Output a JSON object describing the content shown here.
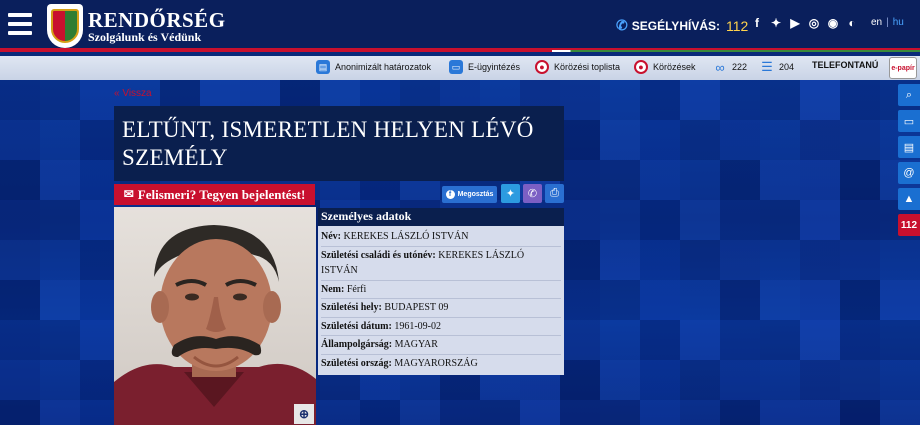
{
  "header": {
    "brand_title": "RENDŐRSÉG",
    "brand_subtitle": "Szolgálunk és Védünk",
    "emergency_label": "SEGÉLYHÍVÁS:",
    "emergency_number": "112",
    "social_icons": [
      "facebook-icon",
      "twitter-icon",
      "youtube-icon",
      "instagram-icon",
      "rss-icon",
      "accessibility-icon"
    ],
    "lang_en": "en",
    "lang_hu": "hu"
  },
  "toolbar": {
    "anon": "Anonimizált határozatok",
    "eugy": "E-ügyintézés",
    "toplista": "Körözési toplista",
    "korozesek": "Körözések",
    "count1": "222",
    "count2": "204",
    "telefon": "TELEFONTANÚ",
    "epapir": "e-papír"
  },
  "sidebar": {
    "icons": [
      "search-icon",
      "monitor-icon",
      "document-icon",
      "at-icon",
      "road-icon",
      "emergency-112-icon"
    ],
    "emergency_label": "112"
  },
  "main": {
    "back_link": "« Vissza",
    "title": "ELTŰNT, ISMERETLEN HELYEN LÉVŐ SZEMÉLY",
    "report_button": "Felismeri? Tegyen bejelentést!",
    "share_label": "Megosztás"
  },
  "personal_data": {
    "heading": "Személyes adatok",
    "rows": [
      {
        "key": "Név:",
        "value": "KEREKES LÁSZLÓ ISTVÁN"
      },
      {
        "key": "Születési családi és utónév:",
        "value": "KEREKES LÁSZLÓ ISTVÁN"
      },
      {
        "key": "Nem:",
        "value": "Férfi"
      },
      {
        "key": "Születési hely:",
        "value": "BUDAPEST 09"
      },
      {
        "key": "Születési dátum:",
        "value": "1961-09-02"
      },
      {
        "key": "Állampolgárság:",
        "value": "MAGYAR"
      },
      {
        "key": "Születési ország:",
        "value": "MAGYARORSZÁG"
      }
    ]
  },
  "colors": {
    "header_bg": "#0a1f5c",
    "accent_red": "#c8102e",
    "panel_bg": "#0a1f4e",
    "data_bg": "#d6dcec"
  }
}
